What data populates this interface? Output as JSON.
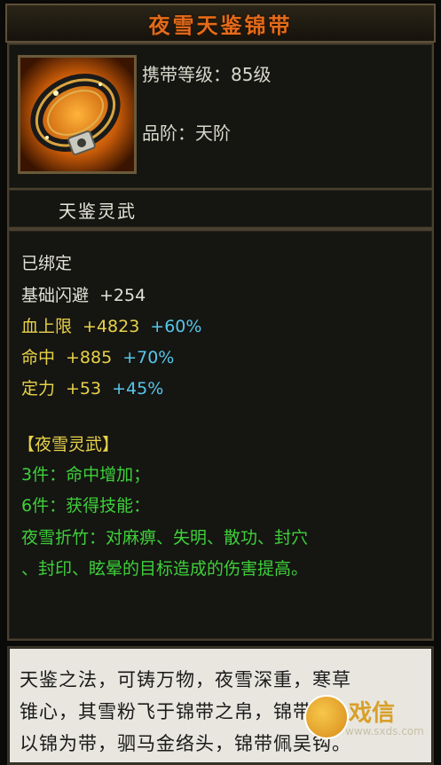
{
  "title": "夜雪天鉴锦带",
  "item": {
    "icon": "golden-belt-icon",
    "carry_level": "携带等级：85级",
    "grade": "品阶：天阶"
  },
  "subtitle": "天鉴灵武",
  "stats": {
    "bound": "已绑定",
    "rows": [
      {
        "name": "基础闪避",
        "base": "+254",
        "bonus": ""
      },
      {
        "name": "血上限",
        "base": "+4823",
        "bonus": "+60%"
      },
      {
        "name": "命中",
        "base": "+885",
        "bonus": "+70%"
      },
      {
        "name": "定力",
        "base": "+53",
        "bonus": "+45%"
      }
    ]
  },
  "set": {
    "name": "【夜雪灵武】",
    "bonus3": "3件：命中增加；",
    "bonus6": "6件：获得技能：",
    "skill_line1": "夜雪折竹：对麻痹、失明、散功、封穴",
    "skill_line2": "、封印、眩晕的目标造成的伤害提高。"
  },
  "description": {
    "line1": "天鉴之法，可铸万物，夜雪深重，寒草",
    "line2": "锥心，其雪粉飞于锦带之帛，锦带者，",
    "line3": "以锦为带，驷马金络头，锦带佩吴钩。"
  },
  "watermark": {
    "site": "www.sxds.com",
    "cn": "戏信"
  },
  "colors": {
    "title": "#e36b1a",
    "stat_base": "#e8d24a",
    "stat_bonus": "#56c6ea",
    "set_text": "#3ed03a"
  }
}
